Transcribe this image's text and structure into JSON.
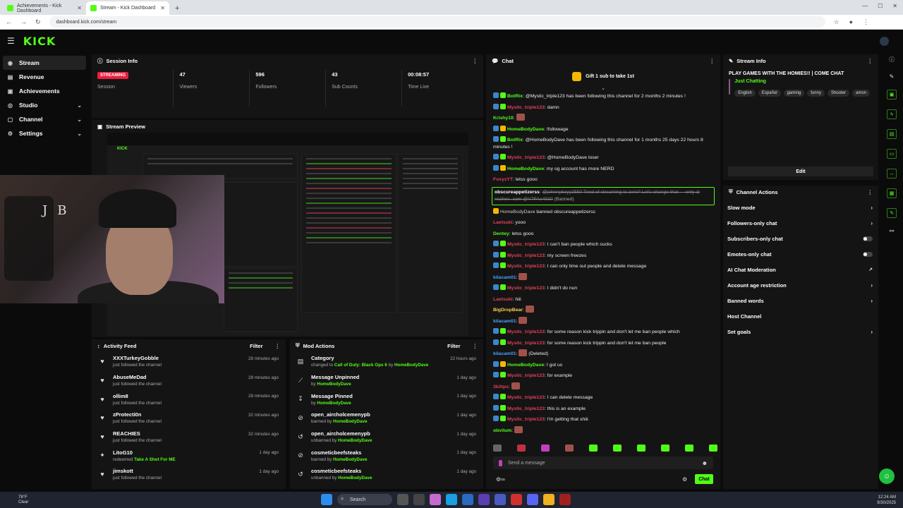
{
  "browser": {
    "tabs": [
      {
        "title": "Achievements - Kick Dashboard",
        "active": false
      },
      {
        "title": "Stream - Kick Dashboard",
        "active": true
      }
    ],
    "url": "dashboard.kick.com/stream"
  },
  "brand": {
    "logo": "KICK",
    "accent": "#53fc18"
  },
  "sidebar": {
    "items": [
      {
        "label": "Stream",
        "active": true,
        "icon": "broadcast-icon",
        "expandable": false
      },
      {
        "label": "Revenue",
        "active": false,
        "icon": "revenue-icon",
        "expandable": false
      },
      {
        "label": "Achievements",
        "active": false,
        "icon": "trophy-icon",
        "expandable": false
      },
      {
        "label": "Studio",
        "active": false,
        "icon": "studio-icon",
        "expandable": true
      },
      {
        "label": "Channel",
        "active": false,
        "icon": "channel-icon",
        "expandable": true
      },
      {
        "label": "Settings",
        "active": false,
        "icon": "gear-icon",
        "expandable": true
      }
    ]
  },
  "session": {
    "title": "Session Info",
    "status_badge": "STREAMING",
    "status_label": "Session",
    "stats": [
      {
        "value": "47",
        "label": "Viewers"
      },
      {
        "value": "596",
        "label": "Followers"
      },
      {
        "value": "43",
        "label": "Sub Counts"
      },
      {
        "value": "00:08:57",
        "label": "Time Live"
      }
    ]
  },
  "preview": {
    "title": "Stream Preview"
  },
  "activity": {
    "title": "Activity Feed",
    "filter": "Filter",
    "items": [
      {
        "name": "XXXTurkeyGobble",
        "desc": "just followed the channel",
        "time": "28 minutes ago",
        "icon": "heart-icon"
      },
      {
        "name": "AbuseMeDad",
        "desc": "just followed the channel",
        "time": "28 minutes ago",
        "icon": "heart-icon"
      },
      {
        "name": "ollim8",
        "desc": "just followed the channel",
        "time": "28 minutes ago",
        "icon": "heart-icon"
      },
      {
        "name": "zProtecti0n",
        "desc": "just followed the channel",
        "time": "32 minutes ago",
        "icon": "heart-icon"
      },
      {
        "name": "REACHIES",
        "desc": "just followed the channel",
        "time": "32 minutes ago",
        "icon": "heart-icon"
      },
      {
        "name": "LitoG10",
        "desc": "redeemed",
        "highlight": "Take A Shot For ME",
        "time": "1 day ago",
        "icon": "reward-icon"
      },
      {
        "name": "jimskott",
        "desc": "just followed the channel",
        "time": "1 day ago",
        "icon": "heart-icon"
      }
    ]
  },
  "mod": {
    "title": "Mod Actions",
    "filter": "Filter",
    "items": [
      {
        "name": "Category",
        "pre": "changed to",
        "highlight": "Call of Duty: Black Ops 6",
        "mid": "by",
        "by": "HomeBodyDave",
        "time": "22 hours ago",
        "icon": "category-icon"
      },
      {
        "name": "Message Unpinned",
        "pre": "by",
        "highlight": "",
        "mid": "",
        "by": "HomeBodyDave",
        "time": "1 day ago",
        "icon": "unpin-icon"
      },
      {
        "name": "Message Pinned",
        "pre": "by",
        "highlight": "",
        "mid": "",
        "by": "HomeBodyDave",
        "time": "1 day ago",
        "icon": "pin-icon"
      },
      {
        "name": "open_aircholcemenypb",
        "pre": "banned by",
        "highlight": "",
        "mid": "",
        "by": "HomeBodyDave",
        "time": "1 day ago",
        "icon": "ban-icon"
      },
      {
        "name": "open_aircholcemenypb",
        "pre": "unbanned by",
        "highlight": "",
        "mid": "",
        "by": "HomeBodyDave",
        "time": "1 day ago",
        "icon": "unban-icon"
      },
      {
        "name": "cosmeticbeefsteaks",
        "pre": "banned by",
        "highlight": "",
        "mid": "",
        "by": "HomeBodyDave",
        "time": "1 day ago",
        "icon": "ban-icon"
      },
      {
        "name": "cosmeticbeefsteaks",
        "pre": "unbanned by",
        "highlight": "",
        "mid": "",
        "by": "HomeBodyDave",
        "time": "1 day ago",
        "icon": "unban-icon"
      }
    ]
  },
  "chat": {
    "title": "Chat",
    "gift": "Gift 1 sub to take 1st",
    "placeholder": "Send a message",
    "send": "Chat",
    "messages": [
      {
        "badges": [
          "b",
          "g"
        ],
        "user": "BotRix",
        "color": "ug",
        "text": "@Mystic_triple123 has been following this channel for 2 months 2 minutes !",
        "wrap": false
      },
      {
        "badges": [
          "b",
          "g"
        ],
        "user": "Mystic_triple123",
        "color": "ur",
        "text": "damn",
        "wrap": false
      },
      {
        "badges": [],
        "user": "Krishy10",
        "color": "ug",
        "text": "",
        "emote": true,
        "wrap": false
      },
      {
        "badges": [
          "b",
          "y"
        ],
        "user": "HomeBodyDave",
        "color": "ug",
        "text": "!followage",
        "wrap": false
      },
      {
        "badges": [
          "b",
          "g"
        ],
        "user": "BotRix",
        "color": "ug",
        "text": "@HomeBodyDave has been following this channel for 1 months 25 days 22 hours 8 minutes !",
        "wrap": true
      },
      {
        "badges": [
          "b",
          "g"
        ],
        "user": "Mystic_triple123",
        "color": "ur",
        "text": "@HomeBodyDave loser",
        "wrap": false
      },
      {
        "badges": [
          "b",
          "y"
        ],
        "user": "HomeBodyDave",
        "color": "ug",
        "text": "my og account has more NERD",
        "wrap": false
      },
      {
        "badges": [],
        "user": "FoxyzYT",
        "color": "ur",
        "text": "letss gooo",
        "wrap": false
      }
    ],
    "deleted_user": "obscureappetizerss",
    "deleted_text": "@johnnyboyy2550 Tired of streaming to zero? Let's change that — only at nezhns .com @V7FAe4020",
    "deleted_tag": "(Banned)",
    "ban_notice_user": "HomeBodyDave",
    "ban_notice_text": "banned",
    "ban_notice_target": "obscureappetizerss",
    "messages2": [
      {
        "badges": [],
        "user": "Laetsuki",
        "color": "ur",
        "text": "yooo"
      },
      {
        "badges": [],
        "user": "Dentey",
        "color": "ug",
        "text": "letss gooo"
      },
      {
        "badges": [
          "b",
          "g"
        ],
        "user": "Mystic_triple123",
        "color": "ur",
        "text": "I can't ban people which sucks"
      },
      {
        "badges": [
          "b",
          "g"
        ],
        "user": "Mystic_triple123",
        "color": "ur",
        "text": "my screen freezes"
      },
      {
        "badges": [
          "b",
          "g"
        ],
        "user": "Mystic_triple123",
        "color": "ur",
        "text": "I can only time out people and delete message"
      },
      {
        "badges": [],
        "user": "kilacam01",
        "color": "ub",
        "text": "",
        "emote": true
      },
      {
        "badges": [
          "b",
          "g"
        ],
        "user": "Mystic_triple123",
        "color": "ur",
        "text": "I didn't do nun"
      },
      {
        "badges": [],
        "user": "Laetsuki",
        "color": "ur",
        "text": "hiii"
      },
      {
        "badges": [],
        "user": "BigDropBear",
        "color": "uy",
        "text": "",
        "emote": true
      },
      {
        "badges": [],
        "user": "kilacam01",
        "color": "ub",
        "text": "",
        "emote": true
      },
      {
        "badges": [
          "b",
          "g"
        ],
        "user": "Mystic_triple123",
        "color": "ur",
        "text": "for some reason kick trippin and don't let me ban people which"
      },
      {
        "badges": [
          "b",
          "g"
        ],
        "user": "Mystic_triple123",
        "color": "ur",
        "text": "for some reason kick trippin and don't let me ban people"
      },
      {
        "badges": [],
        "user": "kilacam01",
        "color": "ub",
        "text": "(Deleted)",
        "emote": true
      },
      {
        "badges": [
          "b",
          "y"
        ],
        "user": "HomeBodyDave",
        "color": "ug",
        "text": "I got us"
      },
      {
        "badges": [
          "b",
          "g"
        ],
        "user": "Mystic_triple123",
        "color": "ur",
        "text": "for example"
      },
      {
        "badges": [],
        "user": "3b3tps",
        "color": "ur",
        "text": "",
        "emote": true
      },
      {
        "badges": [
          "b",
          "g"
        ],
        "user": "Mystic_triple123",
        "color": "ur",
        "text": "I can delete message"
      },
      {
        "badges": [
          "b",
          "g"
        ],
        "user": "Mystic_triple123",
        "color": "ur",
        "text": "this is an example"
      },
      {
        "badges": [
          "b",
          "g"
        ],
        "user": "Mystic_triple123",
        "color": "ur",
        "text": "I'm getting that shiii"
      },
      {
        "badges": [],
        "user": "obvilum",
        "color": "ug",
        "text": "",
        "emote": true
      }
    ]
  },
  "stream_info": {
    "title": "Stream Info",
    "stream_title": "PLAY GAMES WITH THE HOMIES!! | COME CHAT",
    "category": "Just Chatting",
    "tags": [
      "English",
      "Español",
      "gaming",
      "funny",
      "Shooter",
      "amon"
    ],
    "edit": "Edit"
  },
  "channel_actions": {
    "title": "Channel Actions",
    "items": [
      {
        "label": "Slow mode",
        "control": "arrow"
      },
      {
        "label": "Followers-only chat",
        "control": "arrow"
      },
      {
        "label": "Subscribers-only chat",
        "control": "toggle"
      },
      {
        "label": "Emotes-only chat",
        "control": "toggle"
      },
      {
        "label": "AI Chat Moderation",
        "control": "external"
      },
      {
        "label": "Account age restriction",
        "control": "arrow"
      },
      {
        "label": "Banned words",
        "control": "arrow"
      },
      {
        "label": "Host Channel",
        "control": "none"
      },
      {
        "label": "Set goals",
        "control": "arrow"
      }
    ]
  },
  "taskbar": {
    "weather_temp": "78°F",
    "weather_desc": "Clear",
    "search": "Search",
    "time": "12:24 AM",
    "date": "9/30/2025"
  }
}
